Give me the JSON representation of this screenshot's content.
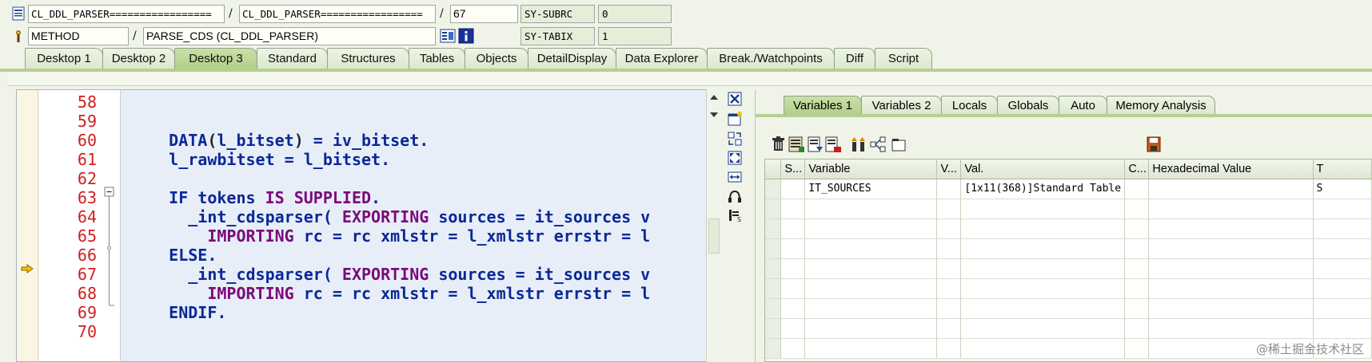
{
  "header": {
    "program_field": "CL_DDL_PARSER=================",
    "include_field": "CL_DDL_PARSER=================",
    "line_field": "67",
    "sysvar1_name": "SY-SUBRC",
    "sysvar1_value": "0",
    "event_type_field": "METHOD",
    "event_field": "PARSE_CDS (CL_DDL_PARSER)",
    "sysvar2_name": "SY-TABIX",
    "sysvar2_value": "1",
    "slash": "/"
  },
  "desktop_tabs": [
    {
      "label": "Desktop 1"
    },
    {
      "label": "Desktop 2"
    },
    {
      "label": "Desktop 3"
    },
    {
      "label": "Standard"
    },
    {
      "label": "Structures"
    },
    {
      "label": "Tables"
    },
    {
      "label": "Objects"
    },
    {
      "label": "DetailDisplay"
    },
    {
      "label": "Data Explorer"
    },
    {
      "label": "Break./Watchpoints"
    },
    {
      "label": "Diff"
    },
    {
      "label": "Script"
    }
  ],
  "active_desktop_tab": "Desktop 3",
  "editor": {
    "current_line": "67",
    "lines": [
      {
        "num": "58",
        "segments": []
      },
      {
        "num": "59",
        "segments": []
      },
      {
        "num": "60",
        "segments": [
          {
            "t": "    DATA",
            "k": "code"
          },
          {
            "t": "(",
            "k": "op"
          },
          {
            "t": "l_bitset",
            "k": "code"
          },
          {
            "t": ")",
            "k": "op"
          },
          {
            "t": " = iv_bitset.",
            "k": "code"
          }
        ]
      },
      {
        "num": "61",
        "segments": [
          {
            "t": "    l_rawbitset = l_bitset.",
            "k": "code"
          }
        ]
      },
      {
        "num": "62",
        "segments": []
      },
      {
        "num": "63",
        "segments": [
          {
            "t": "    IF tokens ",
            "k": "code"
          },
          {
            "t": "IS SUPPLIED",
            "k": "kw"
          },
          {
            "t": ".",
            "k": "code"
          }
        ]
      },
      {
        "num": "64",
        "segments": [
          {
            "t": "      _int_cdsparser( ",
            "k": "code"
          },
          {
            "t": "EXPORTING",
            "k": "kw"
          },
          {
            "t": " sources = it_sources v",
            "k": "code"
          }
        ]
      },
      {
        "num": "65",
        "segments": [
          {
            "t": "        ",
            "k": "code"
          },
          {
            "t": "IMPORTING",
            "k": "kw"
          },
          {
            "t": " rc = rc xmlstr = l_xmlstr errstr = l",
            "k": "code"
          }
        ]
      },
      {
        "num": "66",
        "segments": [
          {
            "t": "    ELSE.",
            "k": "code"
          }
        ]
      },
      {
        "num": "67",
        "segments": [
          {
            "t": "      _int_cdsparser( ",
            "k": "code"
          },
          {
            "t": "EXPORTING",
            "k": "kw"
          },
          {
            "t": " sources = it_sources v",
            "k": "code"
          }
        ]
      },
      {
        "num": "68",
        "segments": [
          {
            "t": "        ",
            "k": "code"
          },
          {
            "t": "IMPORTING",
            "k": "kw"
          },
          {
            "t": " rc = rc xmlstr = l_xmlstr errstr = l",
            "k": "code"
          }
        ]
      },
      {
        "num": "69",
        "segments": [
          {
            "t": "    ENDIF.",
            "k": "code"
          }
        ]
      },
      {
        "num": "70",
        "segments": []
      }
    ]
  },
  "right_tabs": [
    {
      "label": "Variables 1"
    },
    {
      "label": "Variables 2"
    },
    {
      "label": "Locals"
    },
    {
      "label": "Globals"
    },
    {
      "label": "Auto"
    },
    {
      "label": "Memory Analysis"
    }
  ],
  "active_right_tab": "Variables 1",
  "variables_grid": {
    "columns": [
      "S...",
      "Variable",
      "V...",
      "Val.",
      "C...",
      "Hexadecimal Value",
      "T"
    ],
    "rows": [
      [
        "",
        "IT_SOURCES",
        "",
        "[1x11(368)]Standard Table",
        "",
        "",
        "S"
      ]
    ],
    "empty_rows": 8
  },
  "watermark": "@稀土掘金技术社区",
  "colors": {
    "accent_green": "#b5cf93",
    "line_number_red": "#d02020",
    "code_blue": "#0a2896",
    "keyword_purple": "#7a0a7a"
  }
}
